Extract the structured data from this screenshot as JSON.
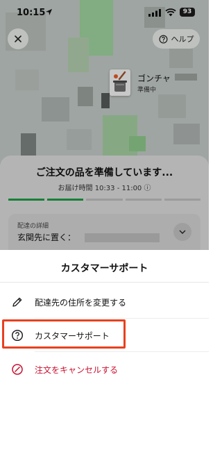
{
  "status_bar": {
    "time": "10:15",
    "battery": "93"
  },
  "map": {
    "help_label": "ヘルプ"
  },
  "store": {
    "name": "ゴンチャ",
    "state": "準備中"
  },
  "order": {
    "title": "ご注文の品を準備しています...",
    "eta": "お届け時間 10:33 - 11:00 ⓘ",
    "progress_segments": [
      true,
      true,
      false,
      false,
      false
    ],
    "detail_label": "配達の詳細",
    "detail_value": "玄関先に置く："
  },
  "sheet": {
    "title": "カスタマーサポート",
    "options": [
      {
        "label": "配達先の住所を変更する",
        "icon": "pencil-icon"
      },
      {
        "label": "カスタマーサポート",
        "icon": "question-circle-icon"
      },
      {
        "label": "注文をキャンセルする",
        "icon": "cancel-circle-icon"
      }
    ]
  },
  "colors": {
    "progress_active": "#1d9b44",
    "cancel_red": "#c8102e",
    "highlight_box": "#e8401f"
  }
}
